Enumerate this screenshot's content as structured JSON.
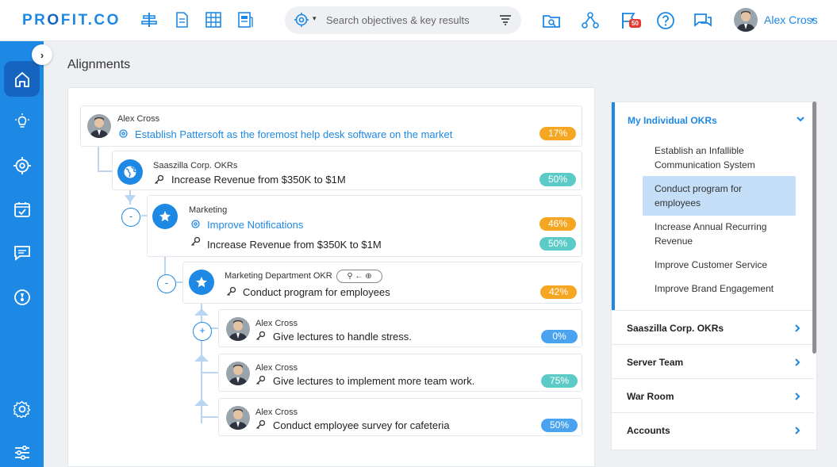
{
  "app": {
    "logo": "PROFIT.CO",
    "logo_dot": "●"
  },
  "header": {
    "search_placeholder": "Search objectives & key results",
    "search_caret": "▾",
    "notification_count": "50",
    "user_name": "Alex Cross",
    "user_caret": "▾",
    "tools": [
      "align-center-icon",
      "document-icon",
      "grid-icon",
      "report-icon"
    ],
    "actions": [
      "folder-search-icon",
      "hierarchy-icon",
      "flag-icon",
      "help-icon",
      "chat-icon"
    ]
  },
  "sidebar": {
    "collapse_glyph": "›",
    "items": [
      "home-icon",
      "idea-icon",
      "target-icon",
      "calendar-check-icon",
      "message-icon",
      "dashboard-icon",
      "settings-icon",
      "sliders-icon"
    ]
  },
  "page": {
    "title": "Alignments"
  },
  "tree": {
    "root": {
      "owner": "Alex Cross",
      "title": "Establish Pattersoft as the foremost help desk software on the market",
      "progress": "17%",
      "progress_color": "#f5a623"
    },
    "corp": {
      "owner": "Saaszilla Corp. OKRs",
      "title": "Increase Revenue from $350K to $1M",
      "progress": "50%",
      "progress_color": "#5ccbc8"
    },
    "marketing": {
      "owner": "Marketing",
      "objective": "Improve Notifications",
      "objective_progress": "46%",
      "key_result": "Increase Revenue from $350K to $1M",
      "key_result_progress": "50%",
      "toggle": "-"
    },
    "dept": {
      "owner": "Marketing Department OKR",
      "chip": "⚲ ← ⊕",
      "title": "Conduct program for employees",
      "progress": "42%",
      "toggle": "-"
    },
    "children": [
      {
        "owner": "Alex Cross",
        "title": "Give lectures to handle stress.",
        "progress": "0%",
        "toggle": "+"
      },
      {
        "owner": "Alex Cross",
        "title": "Give lectures to implement more team work.",
        "progress": "75%"
      },
      {
        "owner": "Alex Cross",
        "title": "Conduct employee survey for cafeteria",
        "progress": "50%"
      }
    ]
  },
  "right_panel": {
    "section_title": "My Individual OKRs",
    "items": [
      "Establish an Infallible Communication System",
      "Conduct program for employees",
      "Increase Annual Recurring Revenue",
      "Improve Customer Service",
      "Improve Brand Engagement"
    ],
    "selected_index": 1,
    "groups": [
      "Saaszilla Corp. OKRs",
      "Server Team",
      "War Room",
      "Accounts"
    ]
  },
  "colors": {
    "brand": "#1e88e5",
    "sidebar": "#1e88e5",
    "orange": "#f5a623",
    "teal": "#5ccbc8",
    "blue": "#4aa3ee"
  }
}
